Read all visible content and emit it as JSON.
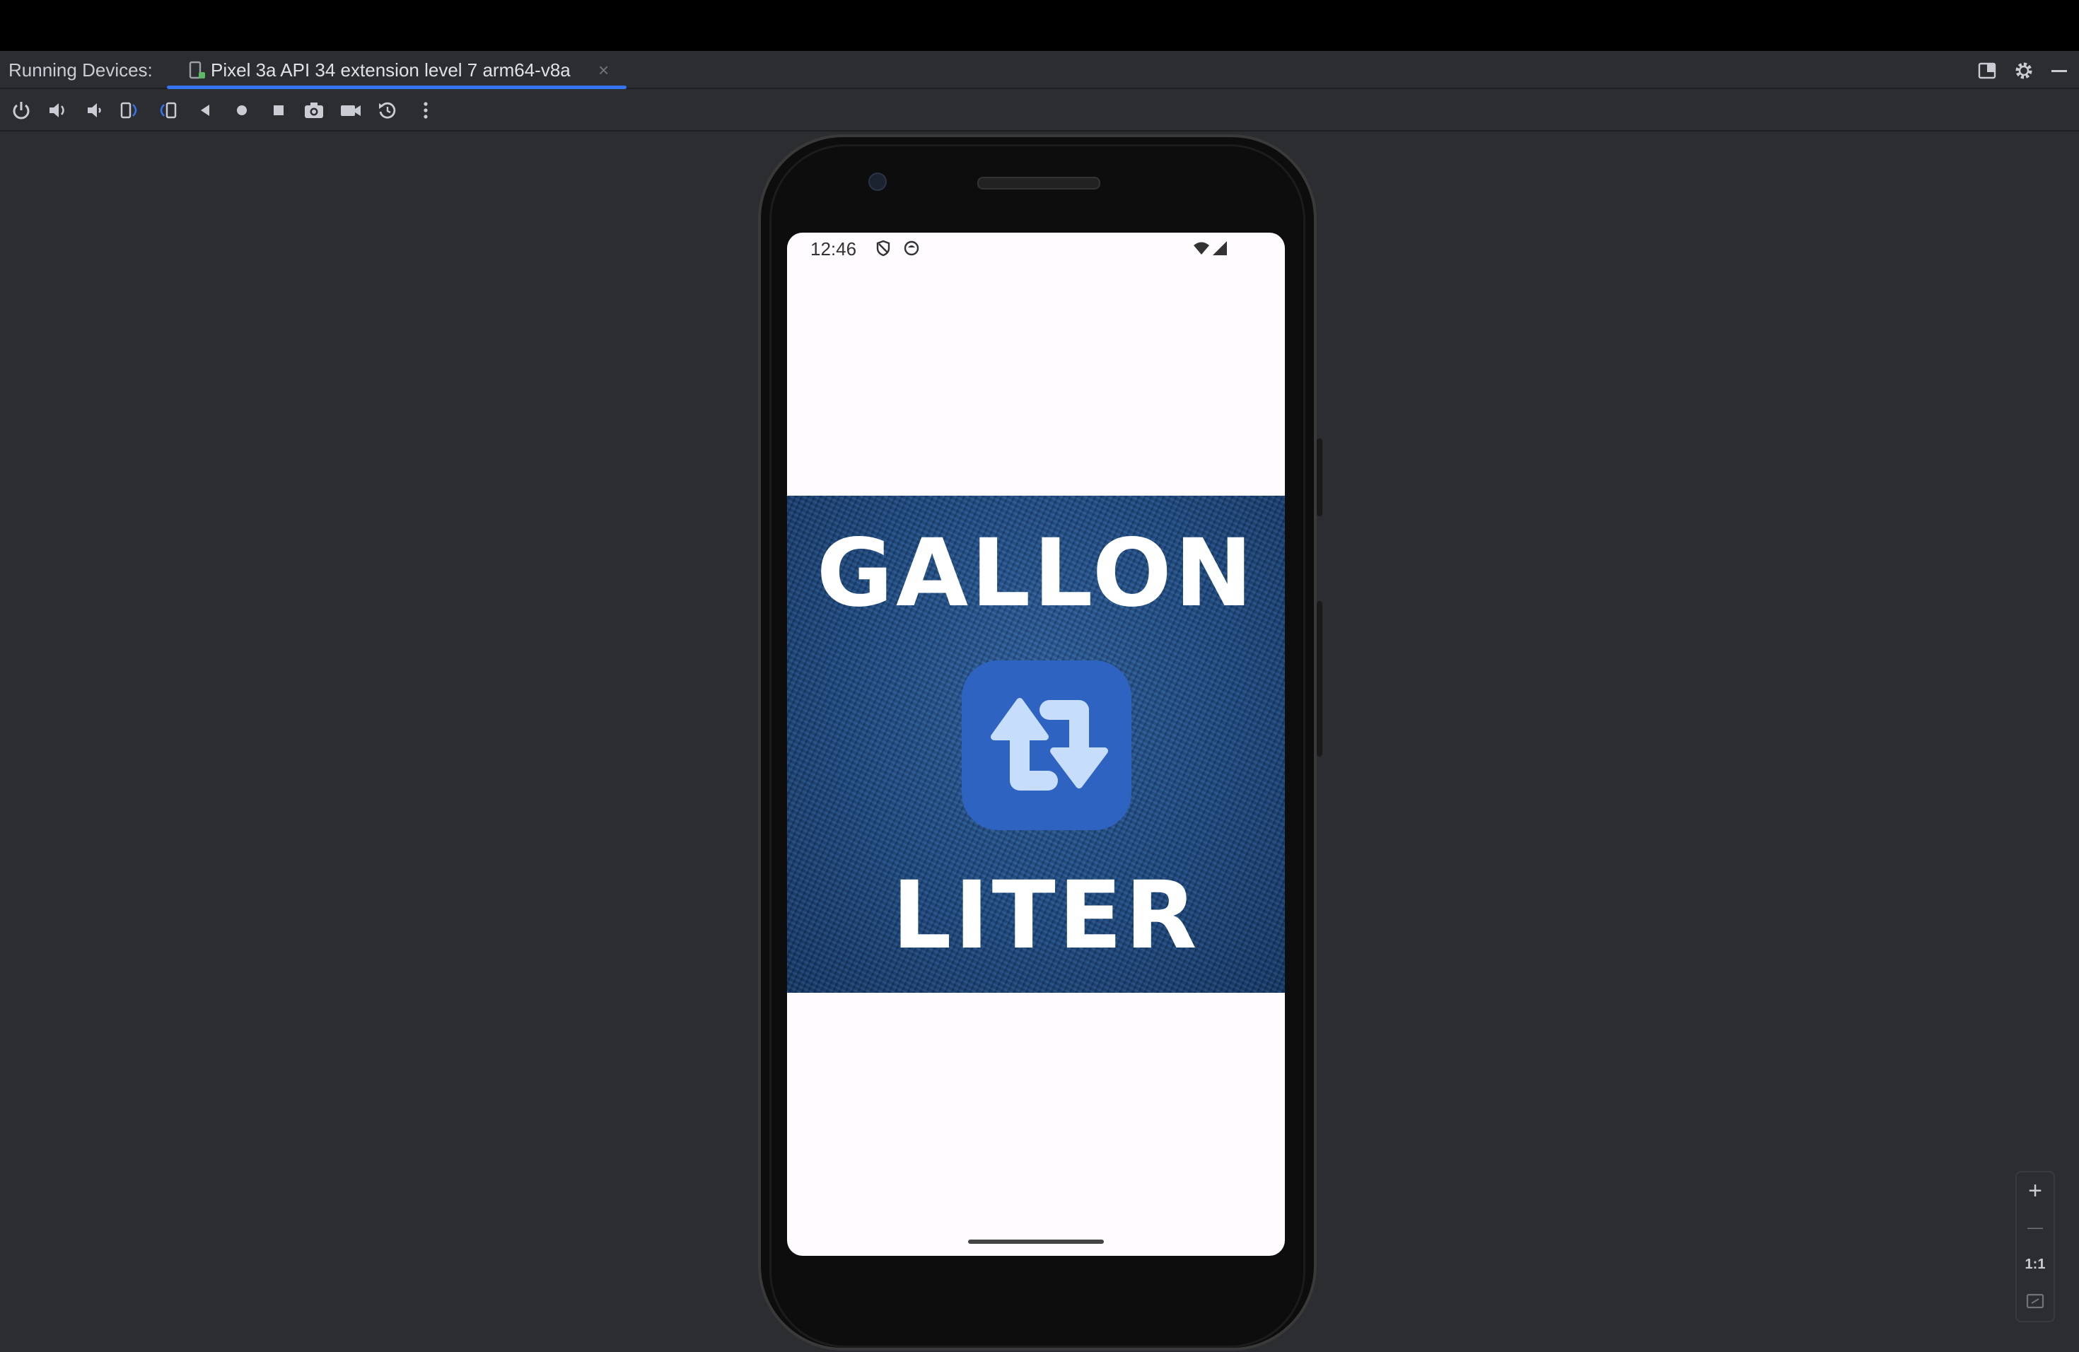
{
  "tabbar": {
    "prefix": "Running Devices:",
    "device_tab": {
      "label": "Pixel 3a API 34 extension level 7 arm64-v8a",
      "close": "×"
    }
  },
  "toolbar": {
    "icons": [
      "power-icon",
      "volume-up-icon",
      "volume-down-icon",
      "rotate-left-icon",
      "rotate-right-icon",
      "back-icon",
      "home-icon",
      "overview-icon",
      "camera-icon",
      "video-icon",
      "reset-icon",
      "more-icon"
    ]
  },
  "device": {
    "status_bar": {
      "time": "12:46"
    },
    "app": {
      "top_text": "GALLON",
      "bottom_text": "LITER"
    }
  },
  "zoom": {
    "plus": "+",
    "minus": "—",
    "actual_size": "1:1"
  },
  "colors": {
    "accent": "#3574f0",
    "banner_blue": "#1d4a82",
    "icon_blue": "#2f63c1",
    "arrow_light": "#c6ddfb",
    "screen_bg": "#fffbfe"
  }
}
